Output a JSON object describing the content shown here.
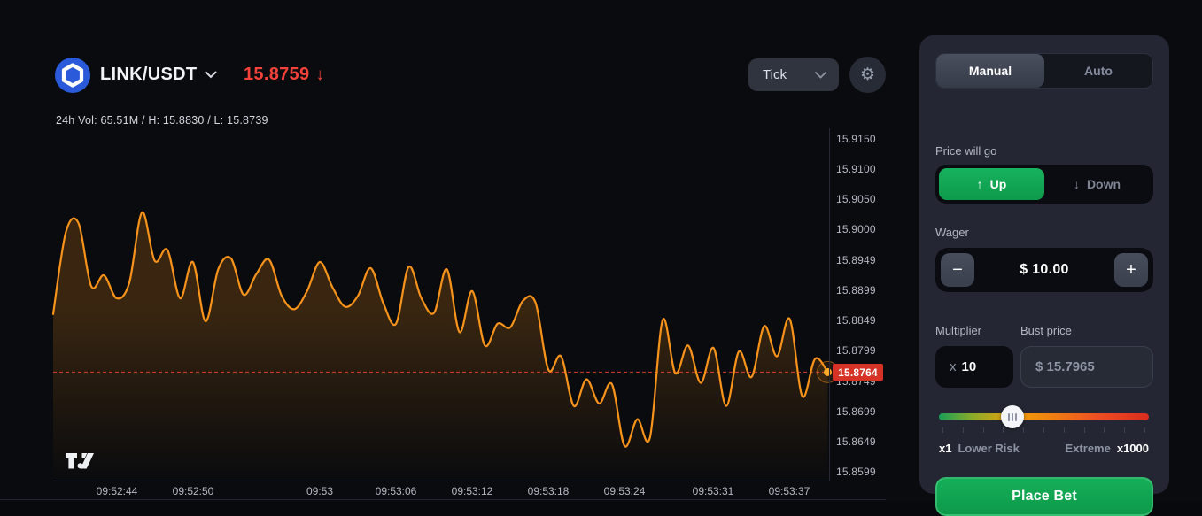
{
  "header": {
    "pair": "LINK/USDT",
    "price": "15.8759",
    "price_direction": "↓",
    "price_color": "#f4423a",
    "stats": "24h Vol: 65.51M / H: 15.8830 / L: 15.8739",
    "interval": "Tick"
  },
  "chart_data": {
    "type": "line",
    "symbol": "LINK/USDT",
    "interval": "Tick",
    "line_color": "#f7931a",
    "fill_color": "rgba(247,147,26,0.20)",
    "current_price": 15.8764,
    "current_price_label": "15.8764",
    "current_price_color": "#d63226",
    "volume_24h": "65.51M",
    "high": "15.8830",
    "low": "15.8739",
    "x_start": "09:52:39",
    "point_interval_seconds": 1,
    "ylim": [
      15.8584,
      15.9167
    ],
    "grid": false,
    "legend": false,
    "prices": [
      15.886,
      15.8995,
      15.901,
      15.8906,
      15.8924,
      15.8886,
      15.8912,
      15.9028,
      15.8948,
      15.8966,
      15.8886,
      15.8946,
      15.8848,
      15.8934,
      15.8952,
      15.8892,
      15.8926,
      15.895,
      15.889,
      15.8868,
      15.8898,
      15.8946,
      15.8904,
      15.8872,
      15.889,
      15.8936,
      15.8878,
      15.8844,
      15.8938,
      15.8886,
      15.8862,
      15.8934,
      15.883,
      15.8898,
      15.8808,
      15.8844,
      15.8838,
      15.8882,
      15.8878,
      15.8768,
      15.879,
      15.8708,
      15.8752,
      15.8712,
      15.8744,
      15.8642,
      15.8686,
      15.8656,
      15.885,
      15.8762,
      15.8808,
      15.8746,
      15.8804,
      15.8708,
      15.8798,
      15.8756,
      15.884,
      15.879,
      15.8852,
      15.8724,
      15.8786,
      15.8764
    ],
    "y_ticks": [
      {
        "label": "15.9150",
        "value": 15.915
      },
      {
        "label": "15.9100",
        "value": 15.91
      },
      {
        "label": "15.9050",
        "value": 15.905
      },
      {
        "label": "15.9000",
        "value": 15.9
      },
      {
        "label": "15.8949",
        "value": 15.8949
      },
      {
        "label": "15.8899",
        "value": 15.8899
      },
      {
        "label": "15.8849",
        "value": 15.8849
      },
      {
        "label": "15.8799",
        "value": 15.8799
      },
      {
        "label": "15.8749",
        "value": 15.8749
      },
      {
        "label": "15.8699",
        "value": 15.8699
      },
      {
        "label": "15.8649",
        "value": 15.8649
      },
      {
        "label": "15.8599",
        "value": 15.8599
      }
    ],
    "x_ticks": [
      {
        "label": "09:52:44",
        "t": 5
      },
      {
        "label": "09:52:50",
        "t": 11
      },
      {
        "label": "09:53",
        "t": 21
      },
      {
        "label": "09:53:06",
        "t": 27
      },
      {
        "label": "09:53:12",
        "t": 33
      },
      {
        "label": "09:53:18",
        "t": 39
      },
      {
        "label": "09:53:24",
        "t": 45
      },
      {
        "label": "09:53:31",
        "t": 52
      },
      {
        "label": "09:53:37",
        "t": 58
      }
    ]
  },
  "panel": {
    "tabs": {
      "manual": "Manual",
      "auto": "Auto"
    },
    "direction": {
      "label": "Price will go",
      "up": "Up",
      "down": "Down",
      "up_arrow": "↑",
      "down_arrow": "↓"
    },
    "wager": {
      "label": "Wager",
      "value": "$ 10.00",
      "minus": "−",
      "plus": "+"
    },
    "multiplier": {
      "label": "Multiplier",
      "prefix": "x",
      "value": "10"
    },
    "bust": {
      "label": "Bust price",
      "value": "$ 15.7965"
    },
    "slider": {
      "position_pct": 35,
      "tick_count": 11,
      "min_mult": "x1",
      "min_text": "Lower Risk",
      "max_text": "Extreme",
      "max_mult": "x1000"
    },
    "place_bet": "Place Bet",
    "accent_green": "#10a452"
  }
}
